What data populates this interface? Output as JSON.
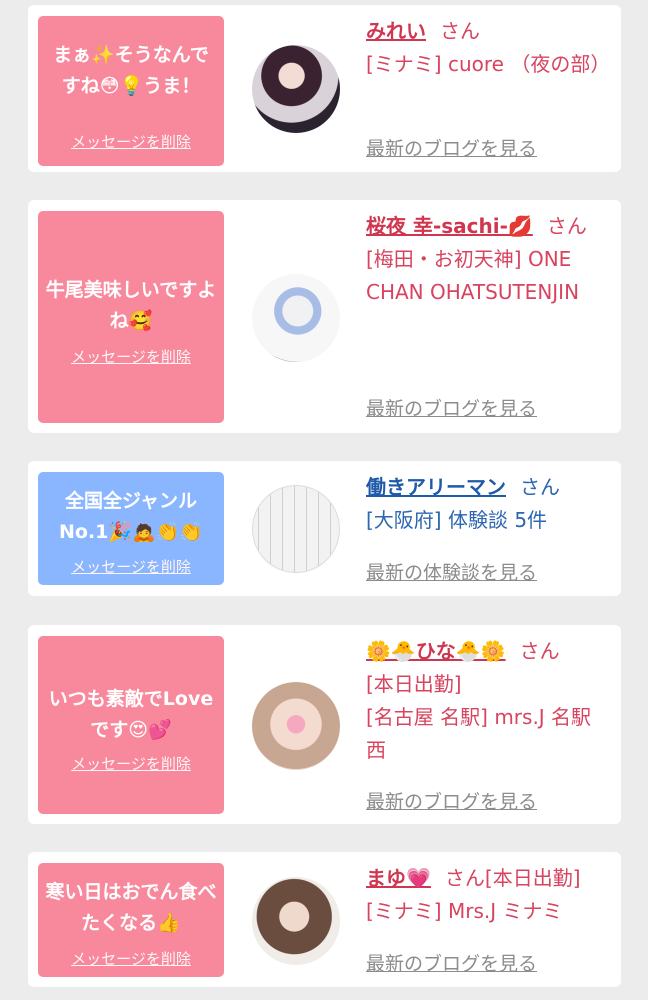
{
  "cards": [
    {
      "message": "まぁ✨そうなんですね😳💡うま！",
      "delete_label": "メッセージを削除",
      "name": "みれい",
      "san": "さん",
      "shop": "[ミナミ] cuore （夜の部）",
      "link": "最新のブログを見る"
    },
    {
      "message": "牛尾美味しいですよね🥰",
      "delete_label": "メッセージを削除",
      "name": "桜夜 幸-sachi-💋",
      "san": "さん",
      "shop": "[梅田・お初天神] ONE CHAN OHATSUTENJIN",
      "link": "最新のブログを見る"
    },
    {
      "message": "全国全ジャンルNo.1🎉🙇👏👏",
      "delete_label": "メッセージを削除",
      "name": "働きアリーマン",
      "san": "さん",
      "shop": "[大阪府] 体験談 5件",
      "link": "最新の体験談を見る"
    },
    {
      "message": "いつも素敵でLoveです😍💕",
      "delete_label": "メッセージを削除",
      "name": "🌼🐣ひな🐣🌼",
      "san": "さん",
      "status": "[本日出勤]",
      "shop": "[名古屋 名駅] mrs.J 名駅西",
      "link": "最新のブログを見る"
    },
    {
      "message": "寒い日はおでん食べたくなる👍",
      "delete_label": "メッセージを削除",
      "name": "まゆ💗",
      "san": "さん[本日出勤]",
      "shop": "[ミナミ] Mrs.J ミナミ",
      "link": "最新のブログを見る"
    }
  ],
  "colors": {
    "pink_bubble": "#f8899c",
    "blue_bubble": "#8ab6ff",
    "pink_text": "#d8445f",
    "blue_text": "#2d66b1",
    "link_gray": "#8c8c8c"
  }
}
